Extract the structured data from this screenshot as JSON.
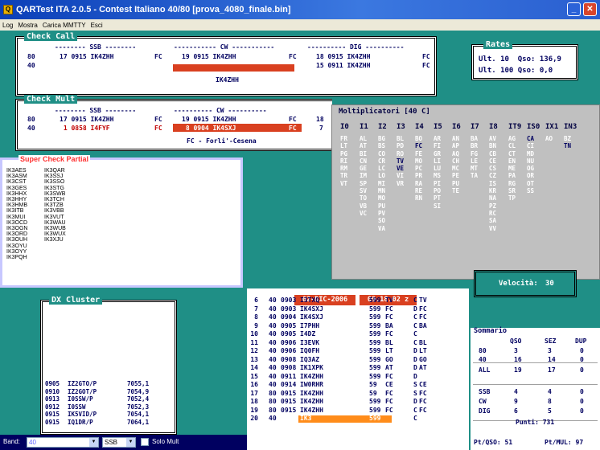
{
  "window": {
    "title": "QARTest ITA 2.0.5 - Contest Italiano 40/80  [prova_4080_finale.bin]"
  },
  "menu": [
    "Log",
    "Mostra",
    "Carica MMTTY",
    "Esci"
  ],
  "check_call": {
    "title": "Check Call",
    "headers": {
      "ssb": "-------- SSB --------",
      "cw": "----------- CW -----------",
      "dig": "---------- DIG ----------"
    },
    "band_labels": [
      "80",
      "40"
    ],
    "ssb_rows": [
      {
        "text": "17 0915 IK4ZHH",
        "prov": "FC"
      }
    ],
    "cw_rows": [
      {
        "text": "19 0915 IK4ZHH",
        "prov": "FC"
      }
    ],
    "dig_rows": [
      {
        "text": "18 0915 IK4ZHH",
        "prov": "FC"
      },
      {
        "text": "15 0911 IK4ZHH",
        "prov": "FC"
      }
    ],
    "call": "IK4ZHH"
  },
  "check_mult": {
    "title": "Check Mult",
    "headers": {
      "ssb": "-------- SSB --------",
      "cw": "---------- CW ----------"
    },
    "rows": [
      {
        "band": "80",
        "ssb": "17 0915 IK4ZHH",
        "ssb_prov": "FC",
        "cw": "19 0915 IK4ZHH",
        "cw_prov": "FC",
        "dig": "18"
      },
      {
        "band": "40",
        "ssb": " 1 0858 I4FYF",
        "ssb_prov": "FC",
        "cw": " 8 0904 IK4SXJ",
        "cw_prov": "FC",
        "dig": "7"
      }
    ],
    "province": "FC - Forli'-Cesena"
  },
  "rates": {
    "line1": "Ult. 10  Qso: 136,9",
    "line2": "Ult. 100 Qso: 0,0",
    "title": "Rates"
  },
  "multiplicatori": {
    "title": "Moltiplicatori [40 C]",
    "columns": [
      {
        "h": "I0",
        "v": [
          "FR",
          "LT",
          "PG",
          "RI",
          "RM",
          "TR",
          "VT"
        ]
      },
      {
        "h": "I1",
        "v": [
          "AL",
          "AT",
          "BI",
          "CN",
          "GE",
          "IM",
          "SP",
          "SV",
          "TO",
          "VB",
          "VC"
        ]
      },
      {
        "h": "I2",
        "v": [
          "BG",
          "BS",
          "CO",
          "CR",
          "LC",
          "LO",
          "MI",
          "MN",
          "MO",
          "PU",
          "PV",
          "SO",
          "VA"
        ]
      },
      {
        "h": "I3",
        "v": [
          "BL",
          "PD",
          "RO",
          "TV",
          "VE",
          "VI",
          "VR"
        ],
        "hot": [
          "TV",
          "VE"
        ]
      },
      {
        "h": "I4",
        "v": [
          "BO",
          "FC",
          "FE",
          "MO",
          "PC",
          "PR",
          "RA",
          "RE",
          "RN"
        ],
        "hot": [
          "FC"
        ]
      },
      {
        "h": "I5",
        "v": [
          "AR",
          "FI",
          "GR",
          "LI",
          "LU",
          "MS",
          "PI",
          "PO",
          "PT",
          "SI"
        ]
      },
      {
        "h": "I6",
        "v": [
          "AN",
          "AP",
          "AQ",
          "CH",
          "MC",
          "PE",
          "PU",
          "TE"
        ]
      },
      {
        "h": "I7",
        "v": [
          "BA",
          "BR",
          "FG",
          "LE",
          "MT",
          "TA"
        ]
      },
      {
        "h": "I8",
        "v": [
          "AV",
          "BN",
          "CB",
          "CE",
          "CS",
          "CZ",
          "IS",
          "KR",
          "NA",
          "PZ",
          "RC",
          "SA",
          "VV"
        ]
      },
      {
        "h": "IT9",
        "v": [
          "AG",
          "CL",
          "CT",
          "EN",
          "ME",
          "PA",
          "RG",
          "SR",
          "TP"
        ]
      },
      {
        "h": "IS0",
        "v": [
          "CA",
          "CI",
          "MD",
          "NU",
          "OG",
          "OR",
          "OT",
          "SS"
        ],
        "hot": [
          "CA"
        ]
      },
      {
        "h": "IX1",
        "v": [
          "AO"
        ]
      },
      {
        "h": "IN3",
        "v": [
          "BZ",
          "TN"
        ],
        "hot": [
          "TN"
        ]
      }
    ]
  },
  "super_check": {
    "title": "Super Check Partial",
    "col1": [
      "IK3AES",
      "IK3ASM",
      "IK3CST",
      "IK3GES",
      "IK3HHX",
      "IK3HHY",
      "IK3HMB",
      "IK3ITB",
      "IK3MUI",
      "IK3OCD",
      "IK3OGN",
      "IK3ORD",
      "IK3OUH",
      "IK3OYU",
      "IK3OYY",
      "IK3PQH"
    ],
    "col2": [
      "IK3QAR",
      "IK3SSJ",
      "IK3SSO",
      "IK3STG",
      "IK3SWB",
      "IK3TCH",
      "IK3TZB",
      "IK3VBB",
      "IK3VUT",
      "IK3WAU",
      "IK3WUB",
      "IK3WUX",
      "IK3XJU"
    ]
  },
  "dx_cluster": {
    "title": "DX Cluster",
    "spots": [
      {
        "time": "0905",
        "call": "IZ2GTO/P",
        "freq": "7055,1"
      },
      {
        "time": "0910",
        "call": "IZ2GOT/P",
        "freq": "7054,9"
      },
      {
        "time": "0913",
        "call": "I0SSW/P",
        "freq": "7052,4"
      },
      {
        "time": "0912",
        "call": "I0SSW",
        "freq": "7052,3"
      },
      {
        "time": "0915",
        "call": "IK5VID/P",
        "freq": "7054,1"
      },
      {
        "time": "0915",
        "call": "IQ1DR/P",
        "freq": "7064,1"
      }
    ]
  },
  "log": {
    "date": "02-DIC-2006",
    "time": "09.18.02 z",
    "rows": [
      {
        "n": "6",
        "b": "40",
        "t": "0903",
        "call": "I3TXQ",
        "rst": "599",
        "rcv": "TV",
        "m": "C",
        "mp": "TV"
      },
      {
        "n": "7",
        "b": "40",
        "t": "0903",
        "call": "IK4SXJ",
        "rst": "599",
        "rcv": "FC",
        "m": "D",
        "mp": "FC"
      },
      {
        "n": "8",
        "b": "40",
        "t": "0904",
        "call": "IK4SXJ",
        "rst": "599",
        "rcv": "FC",
        "m": "C",
        "mp": "FC"
      },
      {
        "n": "9",
        "b": "40",
        "t": "0905",
        "call": "I7PHH",
        "rst": "599",
        "rcv": "BA",
        "m": "C",
        "mp": "BA"
      },
      {
        "n": "10",
        "b": "40",
        "t": "0905",
        "call": "I4DZ",
        "rst": "599",
        "rcv": "FC",
        "m": "C",
        "mp": ""
      },
      {
        "n": "11",
        "b": "40",
        "t": "0906",
        "call": "I3EVK",
        "rst": "599",
        "rcv": "BL",
        "m": "C",
        "mp": "BL"
      },
      {
        "n": "12",
        "b": "40",
        "t": "0906",
        "call": "IQ0FH",
        "rst": "599",
        "rcv": "LT",
        "m": "D",
        "mp": "LT"
      },
      {
        "n": "13",
        "b": "40",
        "t": "0908",
        "call": "IQ3AZ",
        "rst": "599",
        "rcv": "GO",
        "m": "D",
        "mp": "GO"
      },
      {
        "n": "14",
        "b": "40",
        "t": "0908",
        "call": "IK1XPK",
        "rst": "599",
        "rcv": "AT",
        "m": "D",
        "mp": "AT"
      },
      {
        "n": "15",
        "b": "40",
        "t": "0911",
        "call": "IK4ZHH",
        "rst": "599",
        "rcv": "FC",
        "m": "D",
        "mp": ""
      },
      {
        "n": "16",
        "b": "40",
        "t": "0914",
        "call": "IW0RHR",
        "rst": "59",
        "rcv": "CE",
        "m": "S",
        "mp": "CE"
      },
      {
        "n": "17",
        "b": "80",
        "t": "0915",
        "call": "IK4ZHH",
        "rst": "59",
        "rcv": "FC",
        "m": "S",
        "mp": "FC"
      },
      {
        "n": "18",
        "b": "80",
        "t": "0915",
        "call": "IK4ZHH",
        "rst": "599",
        "rcv": "FC",
        "m": "D",
        "mp": "FC"
      },
      {
        "n": "19",
        "b": "80",
        "t": "0915",
        "call": "IK4ZHH",
        "rst": "599",
        "rcv": "FC",
        "m": "C",
        "mp": "FC"
      },
      {
        "n": "20",
        "b": "40",
        "t": "",
        "call": "IK3",
        "rst": "599",
        "rcv": "",
        "m": "C",
        "mp": ""
      }
    ]
  },
  "velocita": {
    "label": "Velocità:",
    "value": "30"
  },
  "sommario": {
    "title": "Sommario",
    "headers": [
      "QSO",
      "SEZ",
      "DUP"
    ],
    "rows": [
      {
        "label": "80",
        "v": [
          "3",
          "3",
          "0"
        ]
      },
      {
        "label": "40",
        "v": [
          "16",
          "14",
          "0"
        ]
      },
      {
        "label": "ALL",
        "v": [
          "19",
          "17",
          "0"
        ]
      },
      {
        "label": "SSB",
        "v": [
          "4",
          "4",
          "0"
        ]
      },
      {
        "label": "CW",
        "v": [
          "9",
          "8",
          "0"
        ]
      },
      {
        "label": "DIG",
        "v": [
          "6",
          "5",
          "0"
        ]
      }
    ],
    "punti": "Punti: 731",
    "ptqso": "Pt/QSO: 51",
    "ptmul": "Pt/MUL: 97"
  },
  "bandbar": {
    "band_label": "Band:",
    "band_value": "40",
    "mode_value": "SSB",
    "solo_mult": "Solo Mult"
  },
  "colors": {
    "background": "#1f8f86",
    "navy": "#000060",
    "accent_red": "#d94020",
    "panel_gray": "#c0c0c0"
  }
}
